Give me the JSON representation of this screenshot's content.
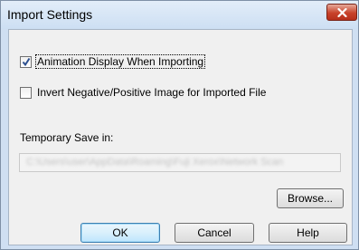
{
  "window": {
    "title": "Import Settings",
    "close_icon": "close-x-icon"
  },
  "options": {
    "animation_display": {
      "label": "Animation Display When Importing",
      "checked": true
    },
    "invert_image": {
      "label": "Invert Negative/Positive Image for Imported File",
      "checked": false
    }
  },
  "temp_save": {
    "label": "Temporary Save in:",
    "path": "C:\\Users\\user\\AppData\\Roaming\\Fuji Xerox\\Network Scan"
  },
  "buttons": {
    "browse": "Browse...",
    "ok": "OK",
    "cancel": "Cancel",
    "help": "Help"
  }
}
